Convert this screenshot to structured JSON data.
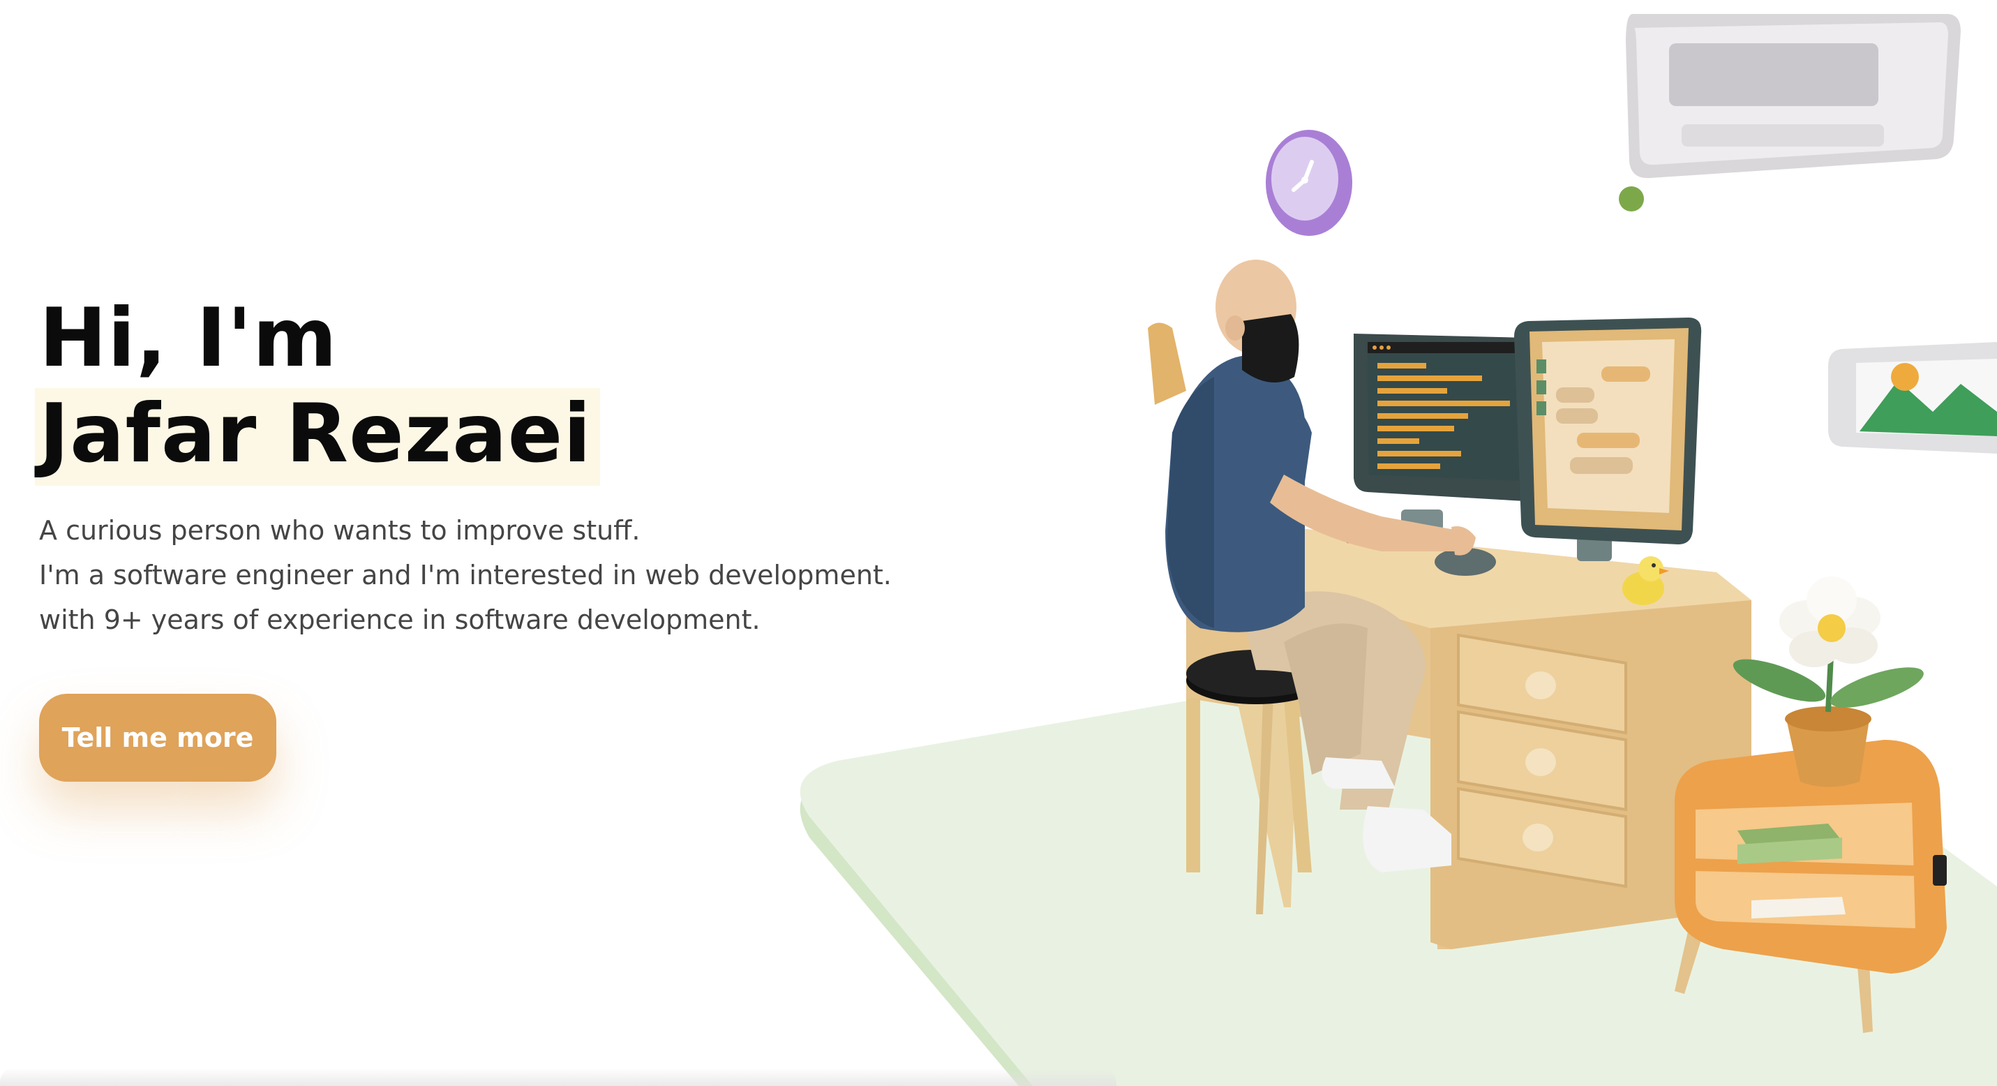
{
  "hero": {
    "greeting": "Hi, I'm",
    "name": "Jafar Rezaei",
    "intro_lines": [
      "A curious person who wants to improve stuff.",
      "I'm a software engineer and I'm interested in web development.",
      "with 9+ years of experience in software development."
    ],
    "cta_label": "Tell me more"
  },
  "illustration": {
    "subject": "3d-developer-workspace",
    "icons": [
      "clock-icon",
      "air-conditioner-icon",
      "image-icon",
      "flower-pot-icon",
      "rubber-duck-icon"
    ]
  },
  "colors": {
    "accent": "#dfa35a",
    "name_highlight": "#fdf8e6",
    "heading": "#0b0b0b",
    "body_text": "#454545",
    "floor": "#e4f0dc",
    "desk": "#e6c48e"
  }
}
